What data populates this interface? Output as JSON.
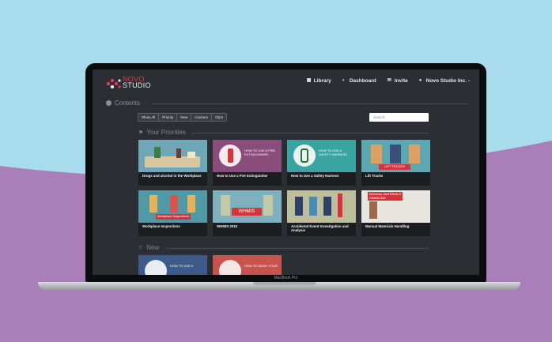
{
  "brand": {
    "line1": "NOVO",
    "line2": "STUDIO"
  },
  "nav": [
    {
      "label": "Library",
      "icon": "grid-icon"
    },
    {
      "label": "Dashboard",
      "icon": "speedometer-icon"
    },
    {
      "label": "Invite",
      "icon": "invite-icon"
    },
    {
      "label": "Novo Studio Inc. -",
      "icon": "user-icon"
    }
  ],
  "contents_title": "Contents",
  "filters": [
    "Show All",
    "Priority",
    "New",
    "Courses",
    "Clips"
  ],
  "search_placeholder": "Search",
  "priorities_title": "Your Priorities",
  "new_title": "New",
  "cards": [
    {
      "label": "Drugs and alcohol in the Workplace",
      "color": "#6fa7b8"
    },
    {
      "label": "How to Use a Fire Extinguisher",
      "color": "#8a4c7a",
      "thumb_text": "HOW TO USE A FIRE EXTINGUISHER"
    },
    {
      "label": "How to Use a Safety Harness",
      "color": "#3aa5a0",
      "thumb_text": "HOW TO USE A SAFETY HARNESS"
    },
    {
      "label": "Lift Trucks",
      "color": "#5da7b3",
      "thumb_text": "LIFT TRUCKS"
    },
    {
      "label": "Workplace Inspections",
      "color": "#4f9aa6",
      "thumb_text": "Workplace Inspections"
    },
    {
      "label": "WHMIS 2015",
      "color": "#7eb0bd",
      "thumb_text": "WHMIS"
    },
    {
      "label": "Accidental Event Investigation and Analysis",
      "color": "#bdbf9c"
    },
    {
      "label": "Manual Materials Handling",
      "color": "#e9e6e2",
      "thumb_text": "MANUAL MATERIALS HANDLING"
    }
  ],
  "new_cards": [
    {
      "color": "#3d5a8a",
      "thumb_text": "HOW TO USE A"
    },
    {
      "color": "#c8524e",
      "thumb_text": "HOW TO WASH YOUR"
    }
  ],
  "laptop_model": "MacBook Pro",
  "colors": {
    "sky": "#a8dbeb",
    "purple": "#a97fba",
    "brand_red": "#e23a52"
  }
}
